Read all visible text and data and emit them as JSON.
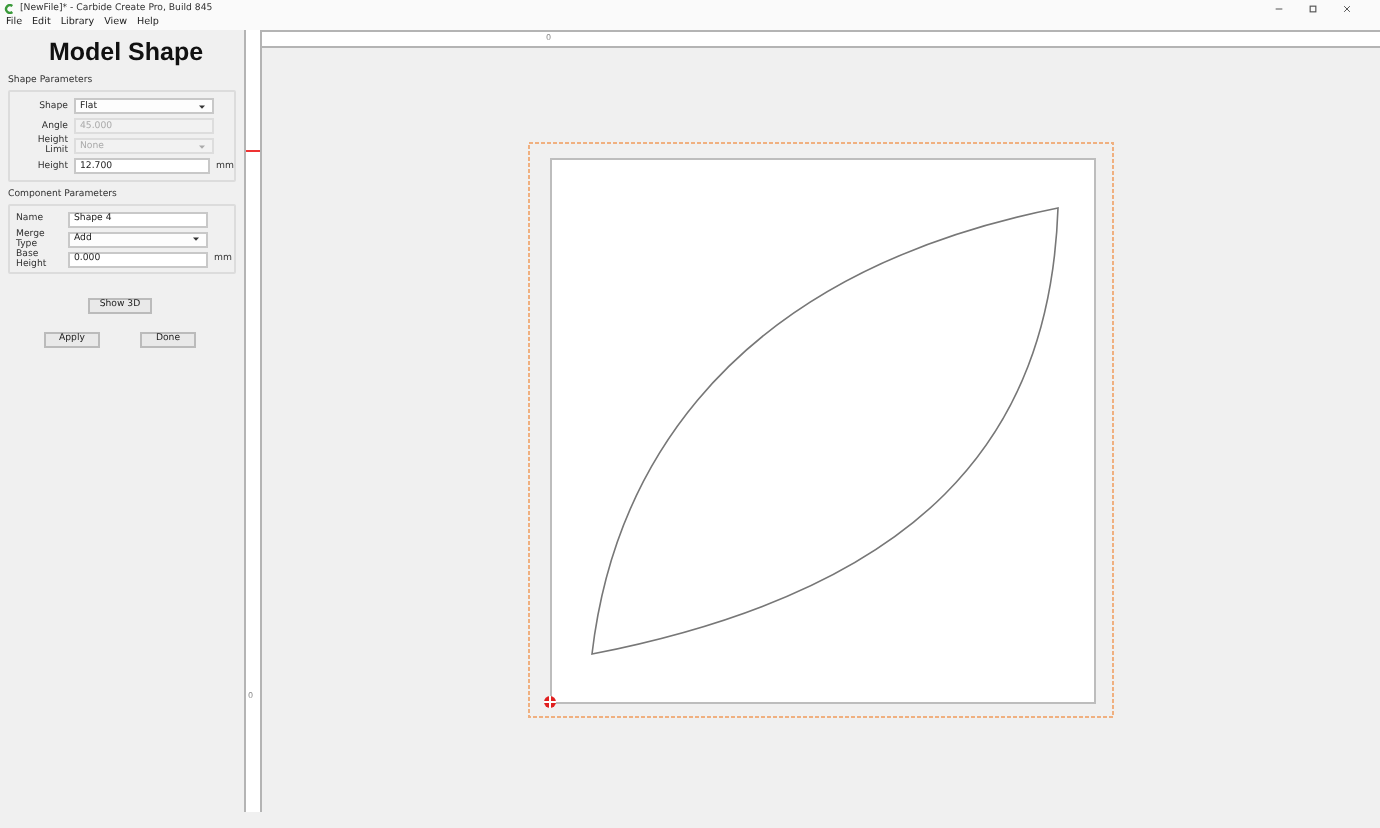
{
  "window": {
    "title": "[NewFile]* - Carbide Create Pro, Build 845"
  },
  "menu": [
    "File",
    "Edit",
    "Library",
    "View",
    "Help"
  ],
  "panel": {
    "title": "Model Shape",
    "sections": [
      {
        "title": "Shape Parameters",
        "fields": [
          {
            "label": "Shape",
            "kind": "dropdown",
            "value": "Flat",
            "disabled": false
          },
          {
            "label": "Angle",
            "kind": "text",
            "value": "45.000",
            "disabled": true
          },
          {
            "label": "Height Limit",
            "kind": "dropdown",
            "value": "None",
            "disabled": true
          },
          {
            "label": "Height",
            "kind": "text",
            "value": "12.700",
            "unit": "mm",
            "disabled": false
          }
        ]
      },
      {
        "title": "Component Parameters",
        "fields": [
          {
            "label": "Name",
            "kind": "text",
            "value": "Shape 4",
            "disabled": false
          },
          {
            "label": "Merge Type",
            "kind": "dropdown",
            "value": "Add",
            "disabled": false
          },
          {
            "label": "Base Height",
            "kind": "text",
            "value": "0.000",
            "unit": "mm",
            "disabled": false
          }
        ]
      }
    ],
    "show_3d": "Show 3D",
    "buttons": [
      "Apply",
      "Done"
    ]
  },
  "rulers": {
    "top_label": "0",
    "left_label": "0"
  }
}
